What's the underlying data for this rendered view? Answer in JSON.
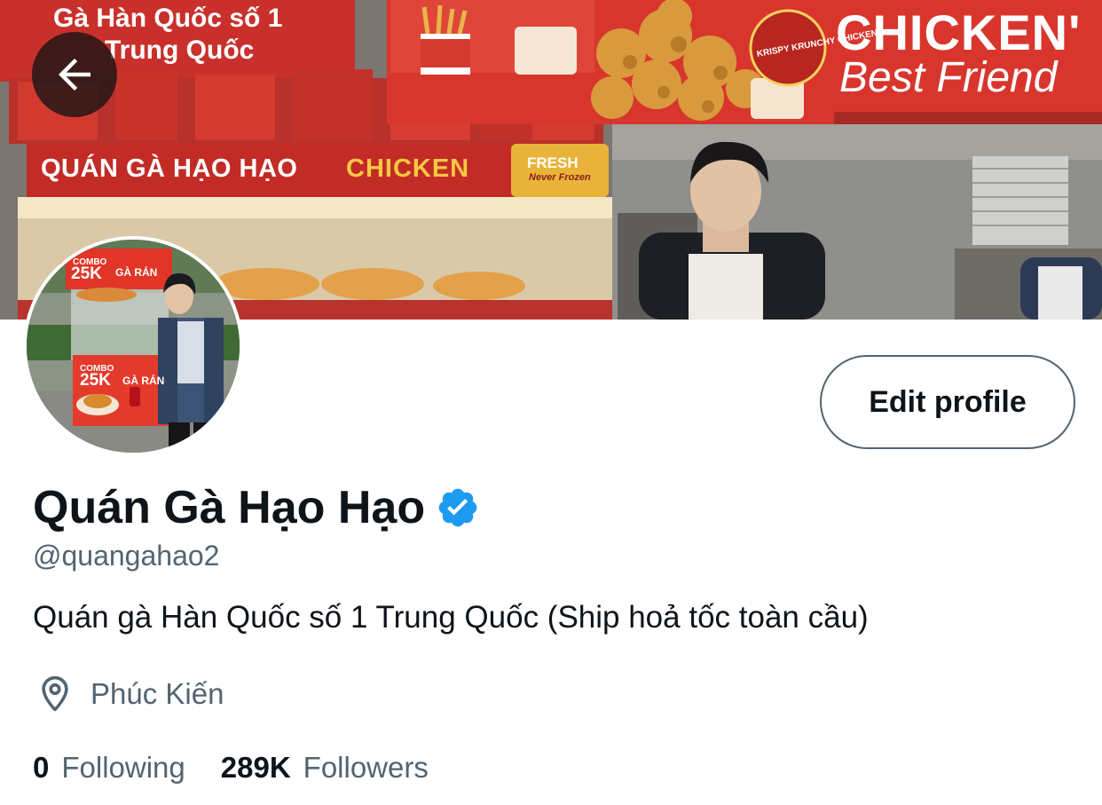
{
  "banner": {
    "sign_korea_line1": "Gà Hàn Quốc số 1",
    "sign_korea_line2": "Trung Quốc",
    "shop_sign_name": "QUÁN GÀ HẠO HẠO",
    "shop_sign_chicken": "CHICKEN",
    "shop_sign_fresh": "FRESH",
    "shop_sign_never_frozen": "Never Frozen",
    "poster_title": "CHICKEN'",
    "poster_subtitle": "Best Friend",
    "poster_logo": "KRISPY KRUNCHY CHICKEN"
  },
  "avatar": {
    "combo_label": "COMBO",
    "price": "25K",
    "item": "GÀ RÁN"
  },
  "header": {
    "back_icon": "arrow-left-icon"
  },
  "actions": {
    "edit_profile_label": "Edit profile"
  },
  "profile": {
    "display_name": "Quán Gà Hạo Hạo",
    "verified_icon": "verified-badge-icon",
    "handle": "@quangahao2",
    "bio": "Quán gà Hàn Quốc số 1 Trung Quốc (Ship hoả tốc toàn cầu)",
    "location_icon": "location-pin-icon",
    "location": "Phúc Kiến"
  },
  "stats": {
    "following_count": "0",
    "following_label": "Following",
    "followers_count": "289K",
    "followers_label": "Followers"
  },
  "colors": {
    "verified_blue": "#1d9bf0",
    "secondary_text": "#536471",
    "primary_text": "#0f1419",
    "sign_red": "#d8312a"
  }
}
